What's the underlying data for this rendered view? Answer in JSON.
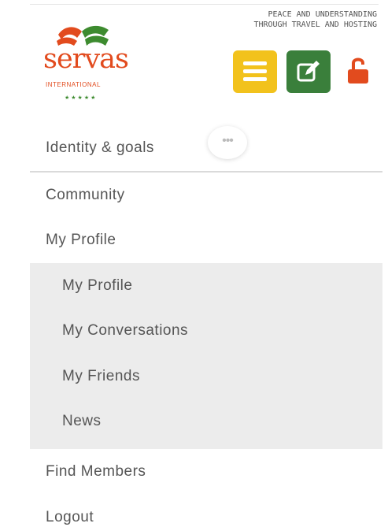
{
  "brand": {
    "name": "servas",
    "subtitle": "INTERNATIONAL",
    "stars": "★★★★★",
    "tagline_line1": "PEACE AND UNDERSTANDING",
    "tagline_line2": "THROUGH TRAVEL AND HOSTING",
    "colors": {
      "orange": "#e24b1e",
      "green": "#3a7f3b",
      "yellow": "#f2c21c"
    }
  },
  "toolbar": {
    "menu_icon": "hamburger-icon",
    "edit_icon": "edit-icon",
    "lock_icon": "unlock-icon"
  },
  "more": {
    "label": "•••"
  },
  "nav": {
    "identity": "Identity & goals",
    "community": "Community",
    "my_profile": "My Profile",
    "submenu": [
      "My Profile",
      "My Conversations",
      "My Friends",
      "News"
    ],
    "find_members": "Find Members",
    "logout": "Logout"
  }
}
